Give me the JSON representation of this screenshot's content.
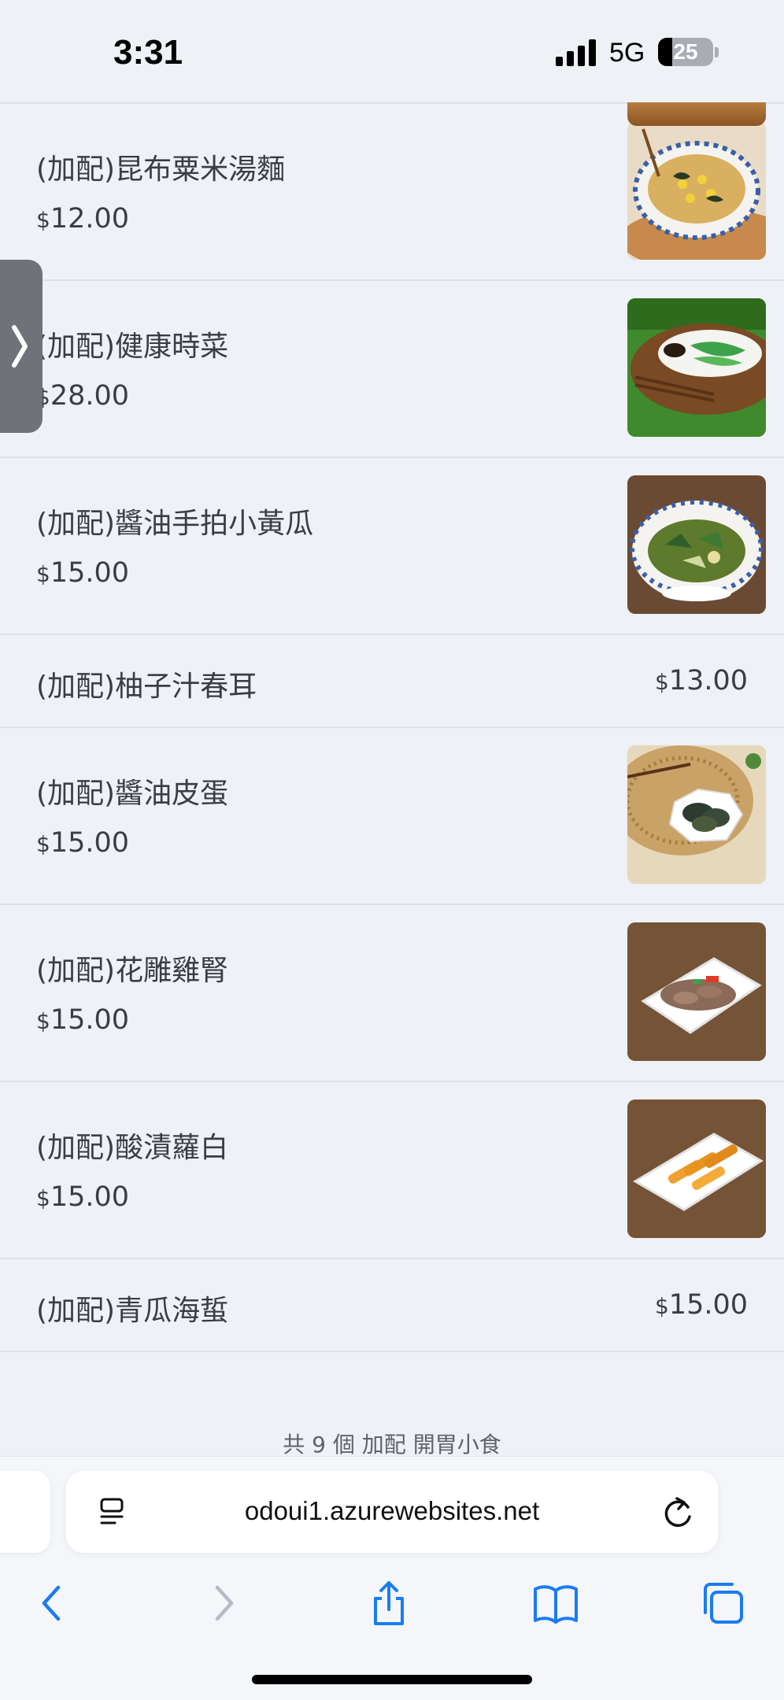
{
  "status_bar": {
    "time": "3:31",
    "network": "5G",
    "battery_percent": "25",
    "battery_level": 0.25
  },
  "menu": {
    "items": [
      {
        "name": "(加配)昆布粟米湯麵",
        "currency": "$",
        "price": "12.00",
        "has_photo": true,
        "photo": "noodle-soup-photo"
      },
      {
        "name": "(加配)健康時菜",
        "currency": "$",
        "price": "28.00",
        "has_photo": true,
        "photo": "greens-photo"
      },
      {
        "name": "(加配)醬油手拍小黃瓜",
        "currency": "$",
        "price": "15.00",
        "has_photo": true,
        "photo": "cucumber-photo"
      },
      {
        "name": "(加配)柚子汁春耳",
        "currency": "$",
        "price": "13.00",
        "has_photo": false
      },
      {
        "name": "(加配)醬油皮蛋",
        "currency": "$",
        "price": "15.00",
        "has_photo": true,
        "photo": "century-egg-photo"
      },
      {
        "name": "(加配)花雕雞腎",
        "currency": "$",
        "price": "15.00",
        "has_photo": true,
        "photo": "chicken-gizzard-photo"
      },
      {
        "name": "(加配)酸漬蘿白",
        "currency": "$",
        "price": "15.00",
        "has_photo": true,
        "photo": "pickled-radish-photo"
      },
      {
        "name": "(加配)青瓜海蜇",
        "currency": "$",
        "price": "15.00",
        "has_photo": false
      }
    ],
    "footer_count": "共 9 個 加配 開胃小食"
  },
  "browser": {
    "url": "odoui1.azurewebsites.net"
  },
  "colors": {
    "page_bg": "#eef1f5",
    "text": "#3a3d44",
    "ios_blue": "#1a7cf2",
    "divider": "#dde1e7"
  }
}
